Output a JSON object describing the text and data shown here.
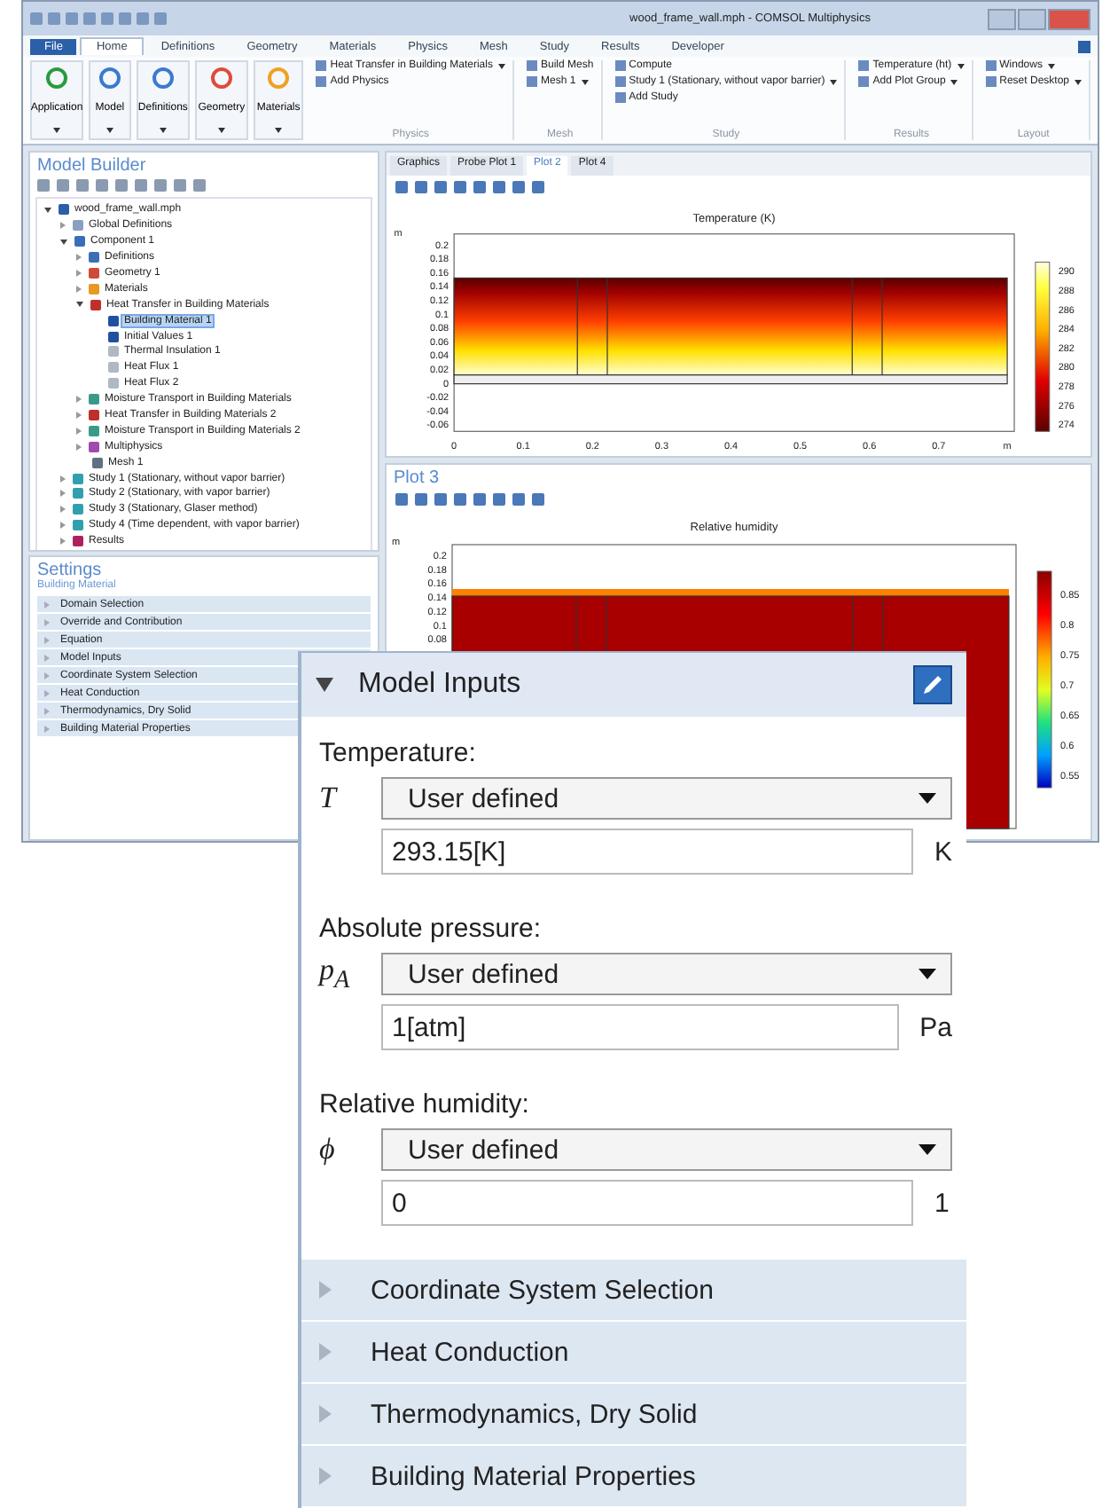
{
  "window": {
    "title": "wood_frame_wall.mph - COMSOL Multiphysics"
  },
  "ribbon_tabs": [
    {
      "label": "File",
      "selected": false,
      "kind": "file"
    },
    {
      "label": "Home",
      "selected": true,
      "kind": "tab"
    },
    {
      "label": "Definitions",
      "selected": false,
      "kind": "tab"
    },
    {
      "label": "Geometry",
      "selected": false,
      "kind": "tab"
    },
    {
      "label": "Materials",
      "selected": false,
      "kind": "tab"
    },
    {
      "label": "Physics",
      "selected": false,
      "kind": "tab"
    },
    {
      "label": "Mesh",
      "selected": false,
      "kind": "tab"
    },
    {
      "label": "Study",
      "selected": false,
      "kind": "tab"
    },
    {
      "label": "Results",
      "selected": false,
      "kind": "tab"
    },
    {
      "label": "Developer",
      "selected": false,
      "kind": "tab"
    }
  ],
  "ribbon_buttons": [
    {
      "label": "Application",
      "kind": "application"
    },
    {
      "label": "Model",
      "kind": "model"
    },
    {
      "label": "Definitions",
      "kind": "definitions"
    },
    {
      "label": "Geometry",
      "kind": "geometry"
    },
    {
      "label": "Materials",
      "kind": "materials"
    }
  ],
  "ribbon_groups": [
    {
      "title": "Physics",
      "items": [
        {
          "label": "Heat Transfer in Building Materials",
          "dropdown": true
        },
        {
          "label": "Add Physics",
          "dropdown": false
        }
      ]
    },
    {
      "title": "Mesh",
      "items": [
        {
          "label": "Build Mesh",
          "dropdown": false
        },
        {
          "label": "Mesh 1",
          "dropdown": true
        }
      ]
    },
    {
      "title": "Study",
      "items": [
        {
          "label": "Compute",
          "dropdown": false
        },
        {
          "label": "Study 1 (Stationary, without vapor barrier)",
          "dropdown": true
        },
        {
          "label": "Add Study",
          "dropdown": false
        }
      ]
    },
    {
      "title": "Results",
      "items": [
        {
          "label": "Temperature (ht)",
          "dropdown": true
        },
        {
          "label": "Add Plot Group",
          "dropdown": true
        }
      ]
    },
    {
      "title": "Layout",
      "items": [
        {
          "label": "Windows",
          "dropdown": true
        },
        {
          "label": "Reset Desktop",
          "dropdown": true
        }
      ]
    }
  ],
  "model_builder": {
    "title": "Model Builder",
    "tree": [
      {
        "label": "wood_frame_wall.mph",
        "kind": "file",
        "expanded": true,
        "selected": false,
        "children": [
          {
            "label": "Global Definitions",
            "kind": "globe",
            "expanded": false,
            "selected": false
          },
          {
            "label": "Component 1",
            "kind": "component",
            "expanded": true,
            "selected": false,
            "children": [
              {
                "label": "Definitions",
                "kind": "definitions",
                "expanded": false,
                "selected": false
              },
              {
                "label": "Geometry 1",
                "kind": "geometry",
                "expanded": false,
                "selected": false
              },
              {
                "label": "Materials",
                "kind": "materials",
                "expanded": false,
                "selected": false
              },
              {
                "label": "Heat Transfer in Building Materials",
                "kind": "physics",
                "expanded": true,
                "selected": false,
                "children": [
                  {
                    "label": "Building Material 1",
                    "kind": "domain",
                    "selected": true
                  },
                  {
                    "label": "Initial Values 1",
                    "kind": "domain",
                    "selected": false
                  },
                  {
                    "label": "Thermal Insulation 1",
                    "kind": "boundary",
                    "selected": false
                  },
                  {
                    "label": "Heat Flux 1",
                    "kind": "boundary",
                    "selected": false
                  },
                  {
                    "label": "Heat Flux 2",
                    "kind": "boundary",
                    "selected": false
                  }
                ]
              },
              {
                "label": "Moisture Transport in Building Materials",
                "kind": "moisture",
                "expanded": false,
                "selected": false
              },
              {
                "label": "Heat Transfer in Building Materials 2",
                "kind": "physics",
                "expanded": false,
                "selected": false
              },
              {
                "label": "Moisture Transport in Building Materials 2",
                "kind": "moisture",
                "expanded": false,
                "selected": false
              },
              {
                "label": "Multiphysics",
                "kind": "multiphysics",
                "expanded": false,
                "selected": false
              },
              {
                "label": "Mesh 1",
                "kind": "mesh",
                "selected": false
              }
            ]
          },
          {
            "label": "Study 1 (Stationary, without vapor barrier)",
            "kind": "study",
            "expanded": false,
            "selected": false
          },
          {
            "label": "Study 2 (Stationary, with vapor barrier)",
            "kind": "study",
            "expanded": false,
            "selected": false
          },
          {
            "label": "Study 3 (Stationary, Glaser method)",
            "kind": "study",
            "expanded": false,
            "selected": false
          },
          {
            "label": "Study 4 (Time dependent, with vapor barrier)",
            "kind": "study",
            "expanded": false,
            "selected": false
          },
          {
            "label": "Results",
            "kind": "results",
            "expanded": false,
            "selected": false
          }
        ]
      }
    ]
  },
  "settings": {
    "title": "Settings",
    "subtitle": "Building Material",
    "sections": [
      "Domain Selection",
      "Override and Contribution",
      "Equation",
      "Model Inputs",
      "Coordinate System Selection",
      "Heat Conduction",
      "Thermodynamics, Dry Solid",
      "Building Material Properties"
    ]
  },
  "graphics_tabs": [
    {
      "label": "Graphics",
      "selected": false
    },
    {
      "label": "Probe Plot 1",
      "selected": false
    },
    {
      "label": "Plot 2",
      "selected": true
    },
    {
      "label": "Plot 4",
      "selected": false
    }
  ],
  "temperature_plot": {
    "title": "Temperature (K)",
    "axis_unit": "m",
    "yticks": [
      "0.2",
      "0.18",
      "0.16",
      "0.14",
      "0.12",
      "0.1",
      "0.08",
      "0.06",
      "0.04",
      "0.02",
      "0",
      "-0.02",
      "-0.04",
      "-0.06"
    ],
    "xticks": [
      "0",
      "0.1",
      "0.2",
      "0.3",
      "0.4",
      "0.5",
      "0.6",
      "0.7"
    ],
    "x_unit": "m",
    "colorbar": [
      "290",
      "288",
      "286",
      "284",
      "282",
      "280",
      "278",
      "276",
      "274"
    ]
  },
  "humidity_plot": {
    "panel_title": "Plot 3",
    "title": "Relative humidity",
    "axis_unit": "m",
    "yticks": [
      "0.2",
      "0.18",
      "0.16",
      "0.14",
      "0.12",
      "0.1",
      "0.08"
    ],
    "colorbar": [
      "0.85",
      "0.8",
      "0.75",
      "0.7",
      "0.65",
      "0.6",
      "0.55"
    ]
  },
  "model_inputs": {
    "title": "Model Inputs",
    "expanded": true,
    "inputs": [
      {
        "label": "Temperature:",
        "symbol": "T",
        "choice": "User defined",
        "value": "293.15[K]",
        "unit": "K"
      },
      {
        "label": "Absolute pressure:",
        "symbol": "p$_{A}$",
        "choice": "User defined",
        "value": "1[atm]",
        "unit": "Pa"
      },
      {
        "label": "Relative humidity:",
        "symbol": "ϕ",
        "choice": "User defined",
        "value": "0",
        "unit": "1"
      }
    ],
    "sections": [
      {
        "label": "Coordinate System Selection",
        "expanded": false
      },
      {
        "label": "Heat Conduction",
        "expanded": false
      },
      {
        "label": "Thermodynamics, Dry Solid",
        "expanded": false
      },
      {
        "label": "Building Material Properties",
        "expanded": false
      }
    ]
  }
}
